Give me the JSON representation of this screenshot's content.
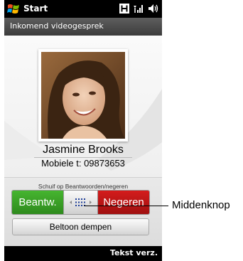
{
  "statusbar": {
    "start_label": "Start",
    "icons": [
      "windows-flag-icon",
      "h-connection-icon",
      "signal-strength-icon",
      "speaker-volume-icon"
    ]
  },
  "call": {
    "header_label": "Inkomend videogesprek",
    "caller_name": "Jasmine Brooks",
    "caller_number": "Mobiele t: 09873653"
  },
  "controls": {
    "slide_hint": "Schuif op Beantwoorden/negeren",
    "answer_label": "Beantw.",
    "reject_label": "Negeren",
    "mute_label": "Beltoon dempen"
  },
  "softkeys": {
    "right_label": "Tekst verz."
  },
  "annotation": {
    "label": "Middenknop"
  },
  "colors": {
    "answer": "#3aa326",
    "reject": "#c41616",
    "knob_dots": "#1f3f9a"
  }
}
